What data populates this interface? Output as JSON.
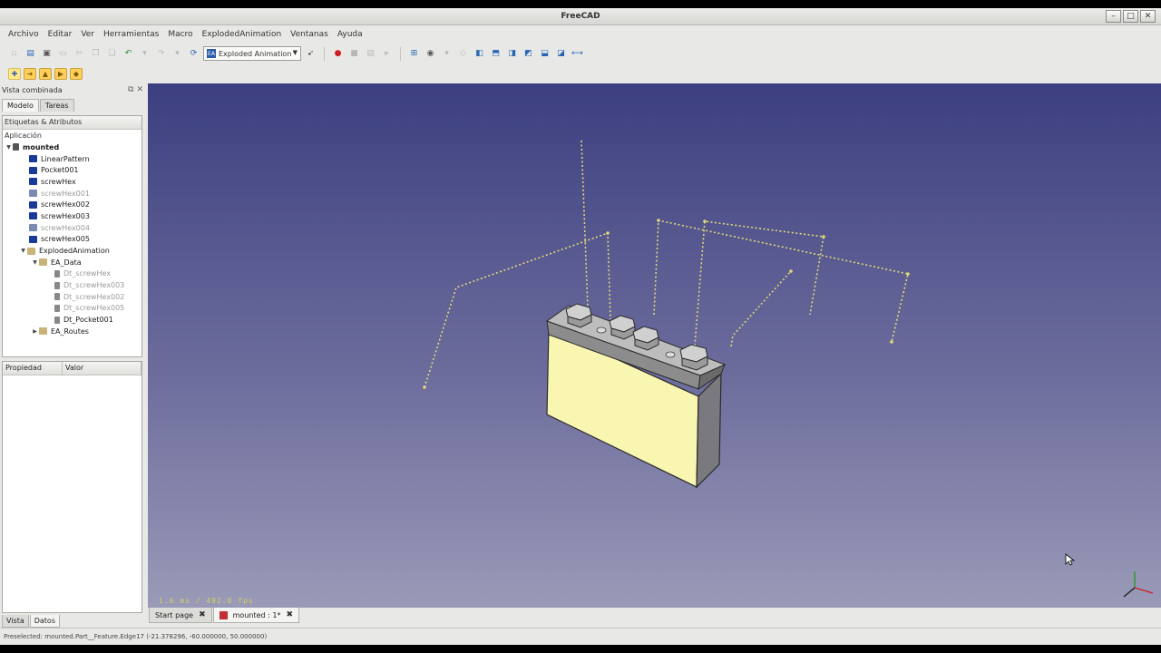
{
  "window": {
    "title": "FreeCAD"
  },
  "window_buttons": [
    "–",
    "□",
    "✕"
  ],
  "menu": [
    "Archivo",
    "Editar",
    "Ver",
    "Herramientas",
    "Macro",
    "ExplodedAnimation",
    "Ventanas",
    "Ayuda"
  ],
  "toolbar": {
    "workbench": "Exploded Animation"
  },
  "combo_view": {
    "title": "Vista combinada",
    "tabs": [
      "Modelo",
      "Tareas"
    ],
    "header": "Etiquetas & Atributos",
    "section": "Aplicación",
    "tree": [
      {
        "label": "mounted"
      },
      {
        "label": "LinearPattern"
      },
      {
        "label": "Pocket001"
      },
      {
        "label": "screwHex"
      },
      {
        "label": "screwHex001"
      },
      {
        "label": "screwHex002"
      },
      {
        "label": "screwHex003"
      },
      {
        "label": "screwHex004"
      },
      {
        "label": "screwHex005"
      },
      {
        "label": "ExplodedAnimation"
      },
      {
        "label": "EA_Data"
      },
      {
        "label": "Dt_screwHex"
      },
      {
        "label": "Dt_screwHex003"
      },
      {
        "label": "Dt_screwHex002"
      },
      {
        "label": "Dt_screwHex005"
      },
      {
        "label": "Dt_Pocket001"
      },
      {
        "label": "EA_Routes"
      }
    ],
    "property_columns": [
      "Propiedad",
      "Valor"
    ],
    "bottom_tabs": [
      "Vista",
      "Datos"
    ]
  },
  "view": {
    "fps_text": "1.6 ms / 492.8 fps"
  },
  "doc_tabs": [
    {
      "label": "Start page"
    },
    {
      "label": "mounted : 1*"
    }
  ],
  "status": "Preselected: mounted.Part__Feature.Edge17 (-21.378296, -60.000000, 50.000000)"
}
